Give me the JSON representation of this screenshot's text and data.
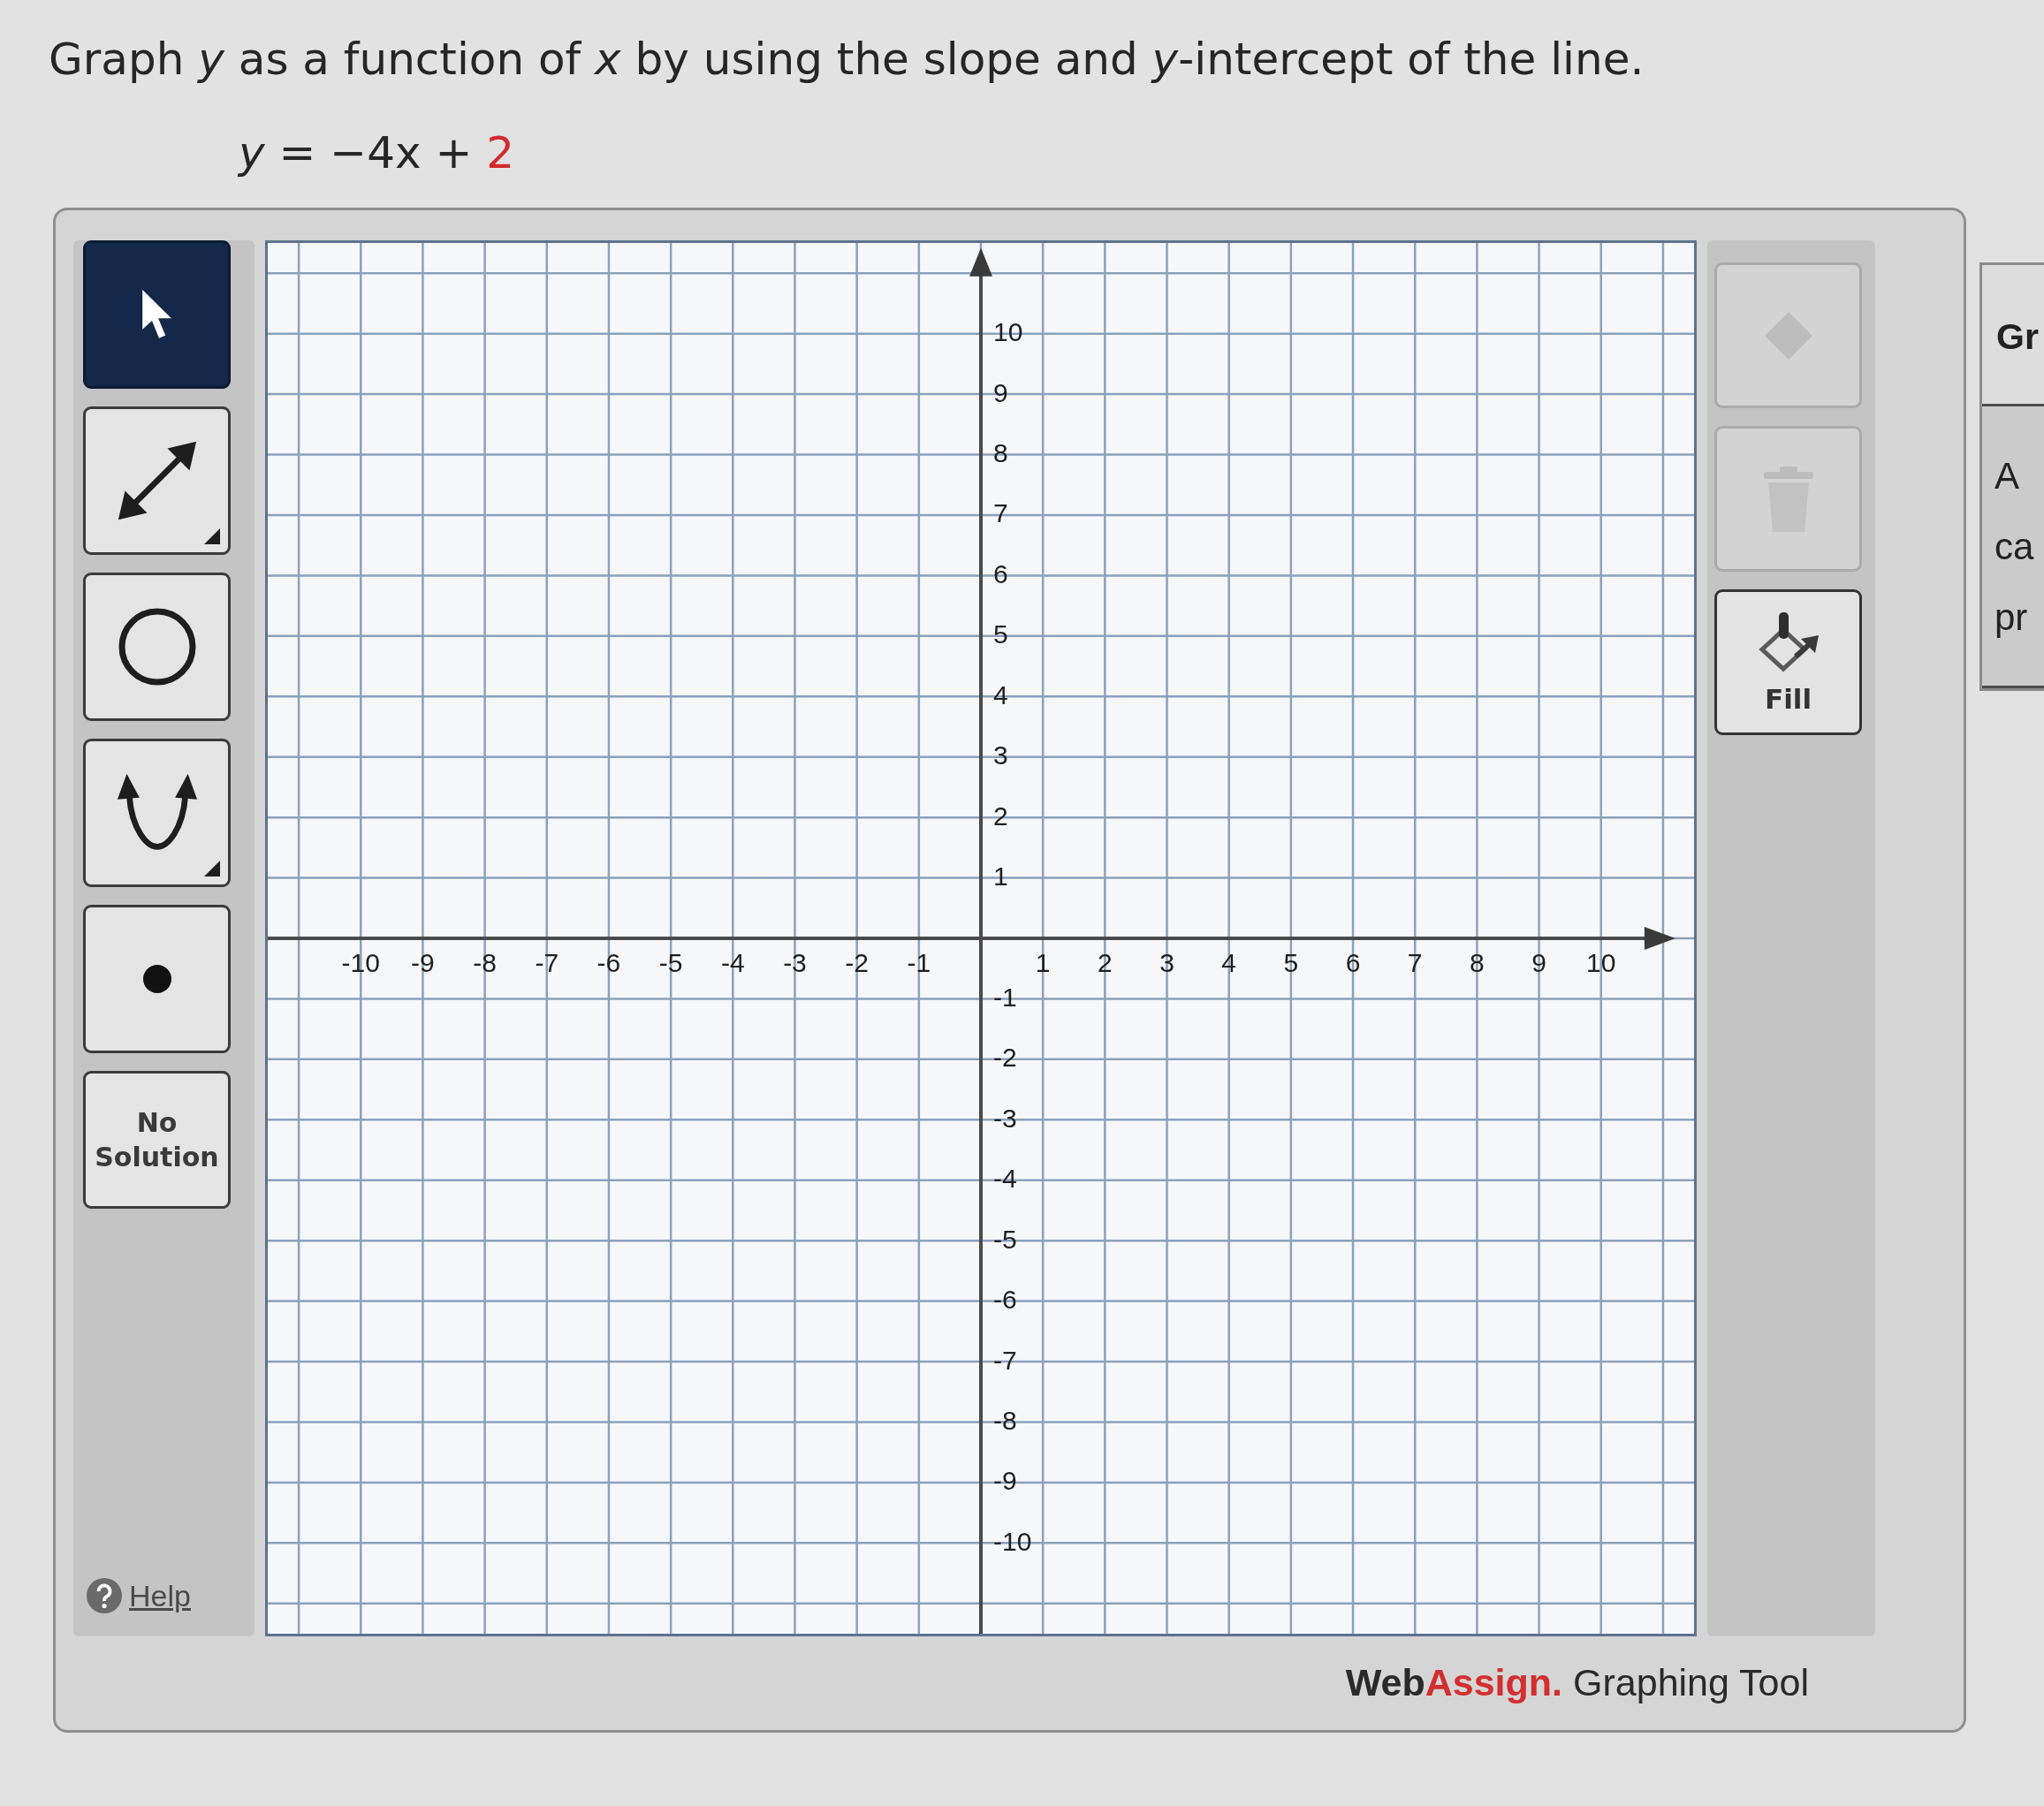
{
  "question": {
    "prompt": "Graph *y* as a function of *x* by using the slope and *y*-intercept of the line.",
    "equation": [
      {
        "text": "*y* = −4x + ",
        "highlight": false
      },
      {
        "text": "2",
        "highlight": true
      }
    ]
  },
  "toolbar": {
    "tools": [
      {
        "kind": "select",
        "selected": true,
        "submenu": false
      },
      {
        "kind": "line",
        "selected": false,
        "submenu": true
      },
      {
        "kind": "circle",
        "selected": false,
        "submenu": false
      },
      {
        "kind": "parabola",
        "selected": false,
        "submenu": true
      },
      {
        "kind": "point",
        "selected": false,
        "submenu": false
      },
      {
        "kind": "no_solution",
        "label": "No Solution",
        "selected": false,
        "submenu": false
      }
    ],
    "help": "Help"
  },
  "graph": {
    "x_labels": [
      "-10",
      "-9",
      "-8",
      "-7",
      "-6",
      "-5",
      "-4",
      "-3",
      "-2",
      "-1",
      "1",
      "2",
      "3",
      "4",
      "5",
      "6",
      "7",
      "8",
      "9",
      "10"
    ],
    "y_labels": [
      "10",
      "9",
      "8",
      "7",
      "6",
      "5",
      "4",
      "3",
      "2",
      "1",
      "-1",
      "-2",
      "-3",
      "-4",
      "-5",
      "-6",
      "-7",
      "-8",
      "-9",
      "-10"
    ]
  },
  "actions": [
    {
      "kind": "diamond",
      "disabled": true
    },
    {
      "kind": "trash",
      "disabled": true
    },
    {
      "kind": "fill",
      "label": "Fill",
      "disabled": false
    }
  ],
  "footer": {
    "brand_dark": "Web",
    "brand_accent": "Assign.",
    "caption": "Graphing Tool"
  },
  "side_panel": {
    "heading": "Gr",
    "lines": [
      "A",
      "ca",
      "pr"
    ]
  }
}
